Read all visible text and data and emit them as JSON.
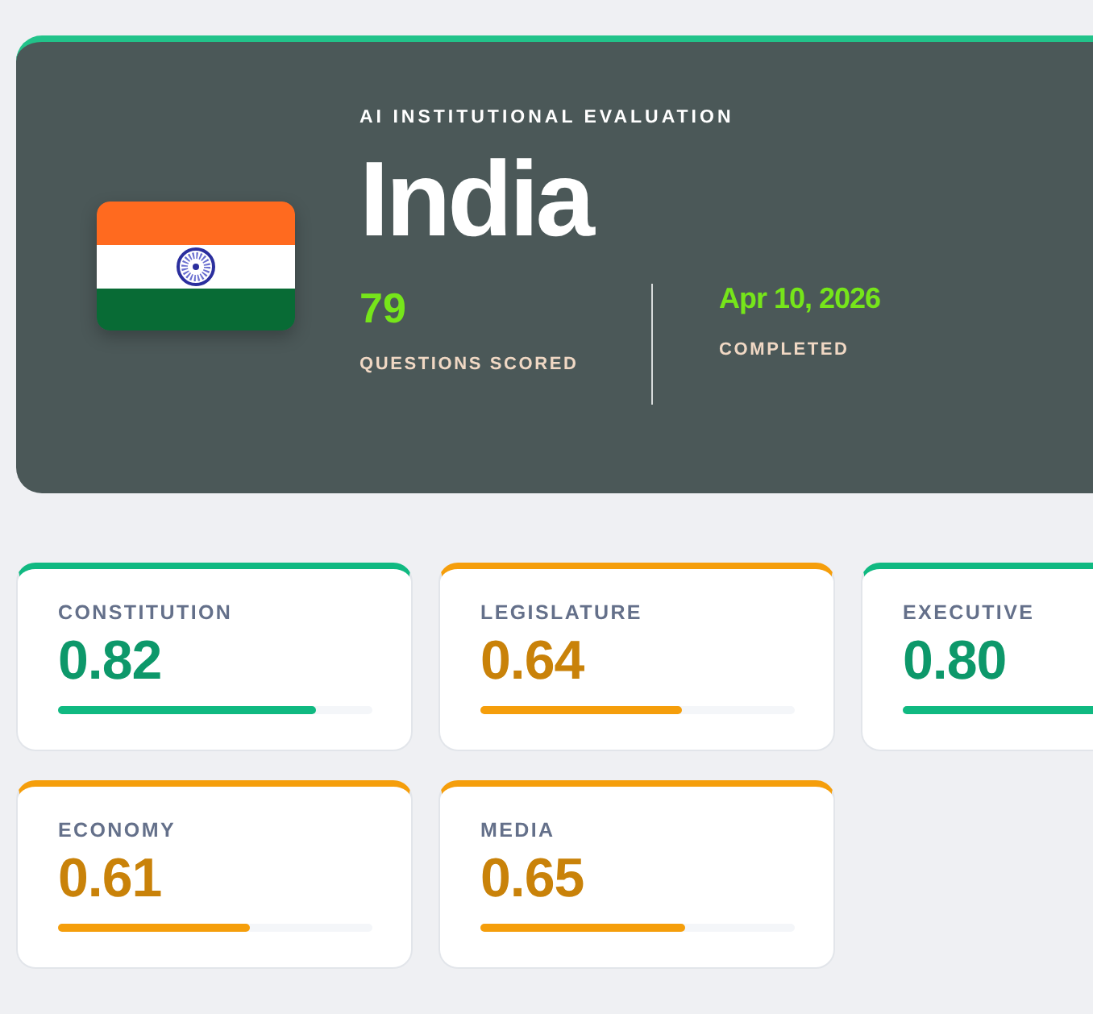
{
  "header": {
    "eyebrow": "AI INSTITUTIONAL EVALUATION",
    "country": "India",
    "stats": [
      {
        "value": "79",
        "label": "QUESTIONS SCORED"
      },
      {
        "value": "Apr 10, 2026",
        "label": "COMPLETED"
      }
    ]
  },
  "scores": [
    {
      "label": "CONSTITUTION",
      "value": "0.82",
      "level": 0.82,
      "color": "#10b981"
    },
    {
      "label": "LEGISLATURE",
      "value": "0.64",
      "level": 0.64,
      "color": "#f59e0b"
    },
    {
      "label": "EXECUTIVE",
      "value": "0.80",
      "level": 0.8,
      "color": "#10b981"
    },
    {
      "label": "ECONOMY",
      "value": "0.61",
      "level": 0.61,
      "color": "#f59e0b"
    },
    {
      "label": "MEDIA",
      "value": "0.65",
      "level": 0.65,
      "color": "#f59e0b"
    }
  ]
}
